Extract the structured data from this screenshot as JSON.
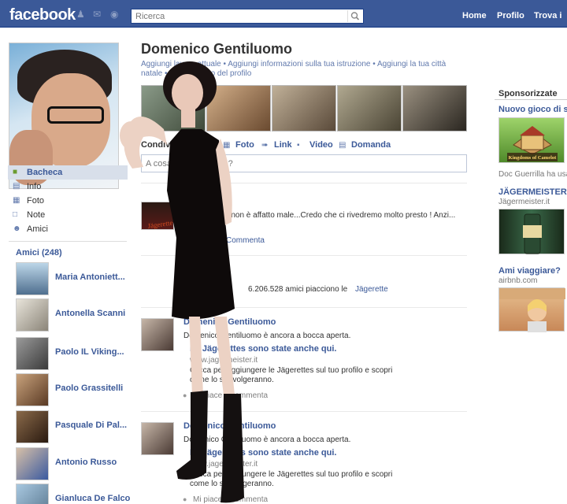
{
  "header": {
    "logo": "facebook",
    "search_placeholder": "Ricerca",
    "nav": [
      "Home",
      "Profilo",
      "Trova i"
    ]
  },
  "sidebar": {
    "menu": [
      {
        "label": "Bacheca",
        "icon": "wall-icon",
        "active": true
      },
      {
        "label": "Info",
        "icon": "info-icon"
      },
      {
        "label": "Foto",
        "icon": "photo-icon"
      },
      {
        "label": "Note",
        "icon": "note-icon"
      },
      {
        "label": "Amici",
        "icon": "friends-icon"
      }
    ],
    "friends_title": "Amici (248)",
    "friends": [
      "Maria Antoniett...",
      "Antonella Scanni",
      "Paolo IL Viking...",
      "Paolo Grassitelli",
      "Pasquale Di Pal...",
      "Antonio Russo",
      "Gianluca De Falco"
    ]
  },
  "profile": {
    "name": "Domenico Gentiluomo",
    "info_line_1": "Aggiungi lavoro attuale • Aggiungi informazioni sulla tua istruzione • Aggiungi la tua città",
    "info_line_2": "natale • Aggiungi foto del profilo"
  },
  "share": {
    "label": "Condividi:",
    "actions": [
      "Foto",
      "Link",
      "Video",
      "Domanda"
    ],
    "composer_placeholder": "A cosa stai pensando?"
  },
  "feed": {
    "post1_text": "...non è affatto male...Credo che ci rivedremo molto presto ! Anzi...",
    "post1_action": "Commenta",
    "page_fans": "6.206.528 amici piacciono le",
    "page_name": "Jägerette",
    "post2": {
      "author": "Domenico Gentiluomo",
      "text": "Domenico Gentiluomo è ancora a bocca aperta.",
      "link_title": "Le Jägerettes sono state anche qui.",
      "link_url": "www.jagermeister.it",
      "desc_1": "Clicca per aggiungere le Jägerettes sul tuo profilo e scopri",
      "desc_2": "come lo stravolgeranno.",
      "meta": "Mi piace · Commenta"
    },
    "post3": {
      "author": "Domenico Gentiluomo",
      "text": "Domenico Gentiluomo è ancora a bocca aperta.",
      "link_title": "Le Jägerettes sono state anche qui.",
      "link_url": "www.jagermeister.it",
      "desc_1": "Clicca per aggiungere le Jägerettes sul tuo profilo e scopri",
      "desc_2": "come lo stravolgeranno.",
      "meta": "Mi piace · Commenta"
    }
  },
  "sponsored": {
    "title": "Sponsorizzate",
    "ads": [
      {
        "title": "Nuovo gioco di st",
        "sub": "Doc Guerrilla ha usa",
        "img_text": "Kingdoms of Camelot"
      },
      {
        "title": "JÄGERMEISTER",
        "sub": "Jägermeister.it"
      },
      {
        "title": "Ami viaggiare?",
        "sub": "airbnb.com"
      }
    ]
  },
  "overlay": {
    "dress_text": "Jägerette"
  },
  "colors": {
    "brand": "#3b5998",
    "link": "#3b5998",
    "panel": "#d8dfea"
  }
}
